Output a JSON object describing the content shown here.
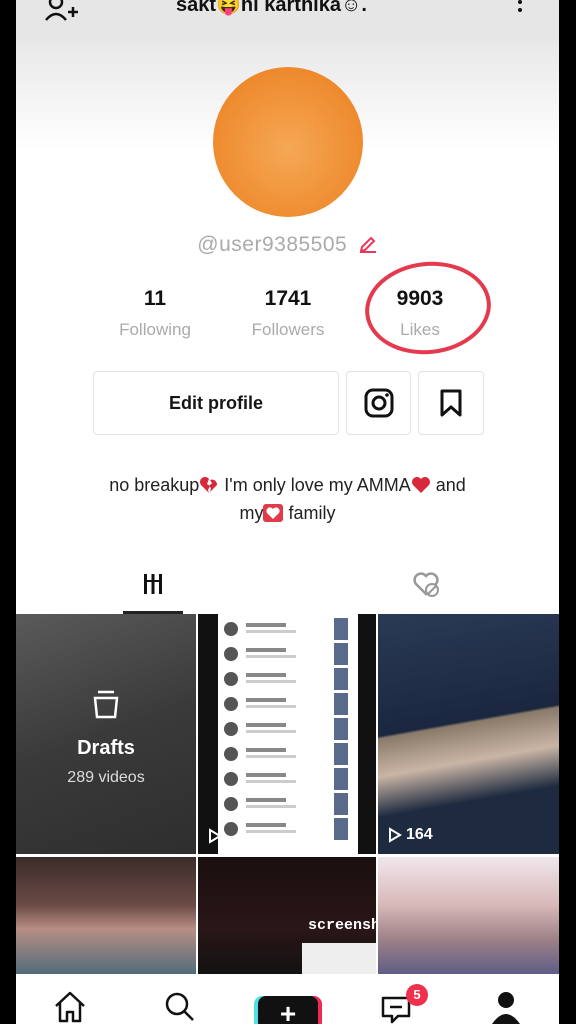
{
  "header": {
    "title": "sakt😝hi karthika☺.",
    "add_user_icon": "add-user-icon",
    "more_icon": "more-vertical-icon"
  },
  "profile": {
    "username": "@user9385505",
    "avatar_color": "#ee8a2d",
    "stats": [
      {
        "value": "11",
        "label": "Following"
      },
      {
        "value": "1741",
        "label": "Followers"
      },
      {
        "value": "9903",
        "label": "Likes"
      }
    ],
    "edit_button": "Edit profile",
    "bio_line1_a": "no breakup",
    "bio_line1_b": " I'm only love my AMMA",
    "bio_line1_c": " and",
    "bio_line2_a": "my",
    "bio_line2_b": " family"
  },
  "grid": {
    "drafts_label": "Drafts",
    "drafts_count": "289 videos",
    "video1_views": "",
    "video2_views": "164",
    "screenshot_caption": "screensh"
  },
  "nav": {
    "plus_label": "+",
    "inbox_badge": "5"
  },
  "colors": {
    "highlight_circle": "#e43a4e",
    "badge": "#f0304d"
  }
}
